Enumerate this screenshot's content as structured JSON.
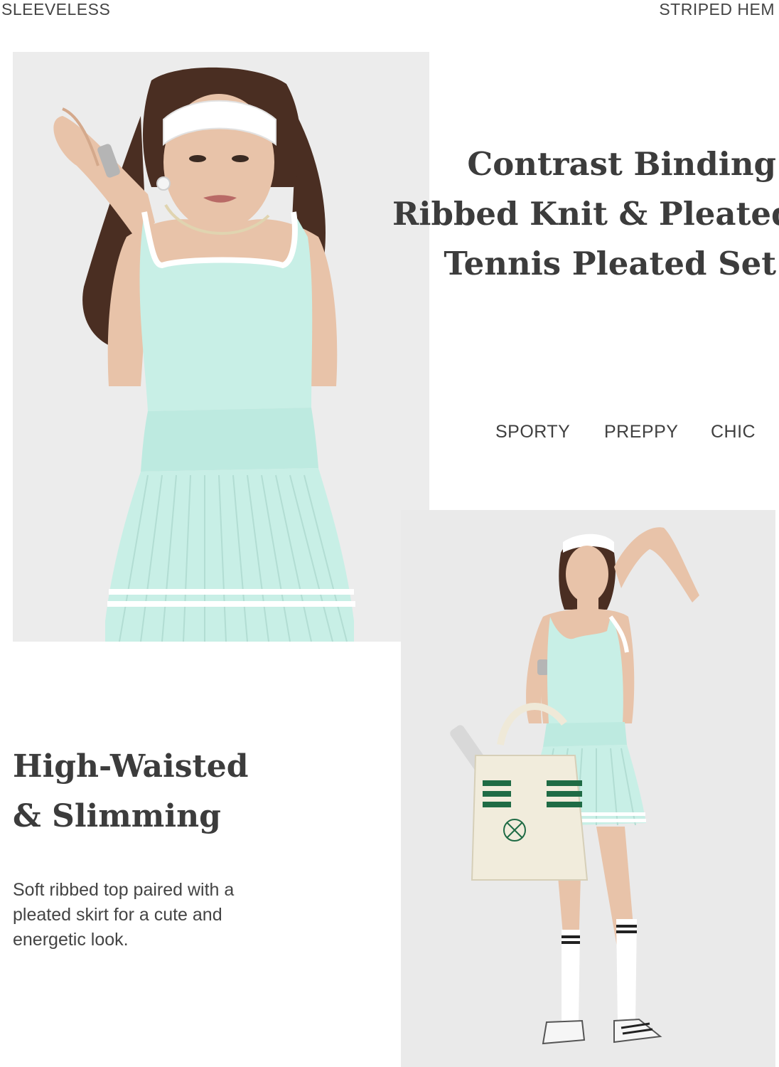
{
  "top_labels": {
    "left": "SLEEVELESS",
    "right": "STRIPED HEM"
  },
  "headline": {
    "line1": "Contrast Binding",
    "line2": "Ribbed Knit & Pleated",
    "line3": "Tennis Pleated Set"
  },
  "style_tags": [
    "SPORTY",
    "PREPPY",
    "CHIC"
  ],
  "feature": {
    "line1": "High-Waisted",
    "line2": "& Slimming",
    "description": "Soft ribbed top paired with a pleated skirt for a cute and energetic look."
  },
  "colors": {
    "outfit_mint": "#c8efe6",
    "trim_white": "#ffffff",
    "bag_stripe_green": "#1f6b45",
    "hair_brown": "#4a2e22",
    "skin": "#e8c3a9",
    "photo_background": "#ececec"
  }
}
